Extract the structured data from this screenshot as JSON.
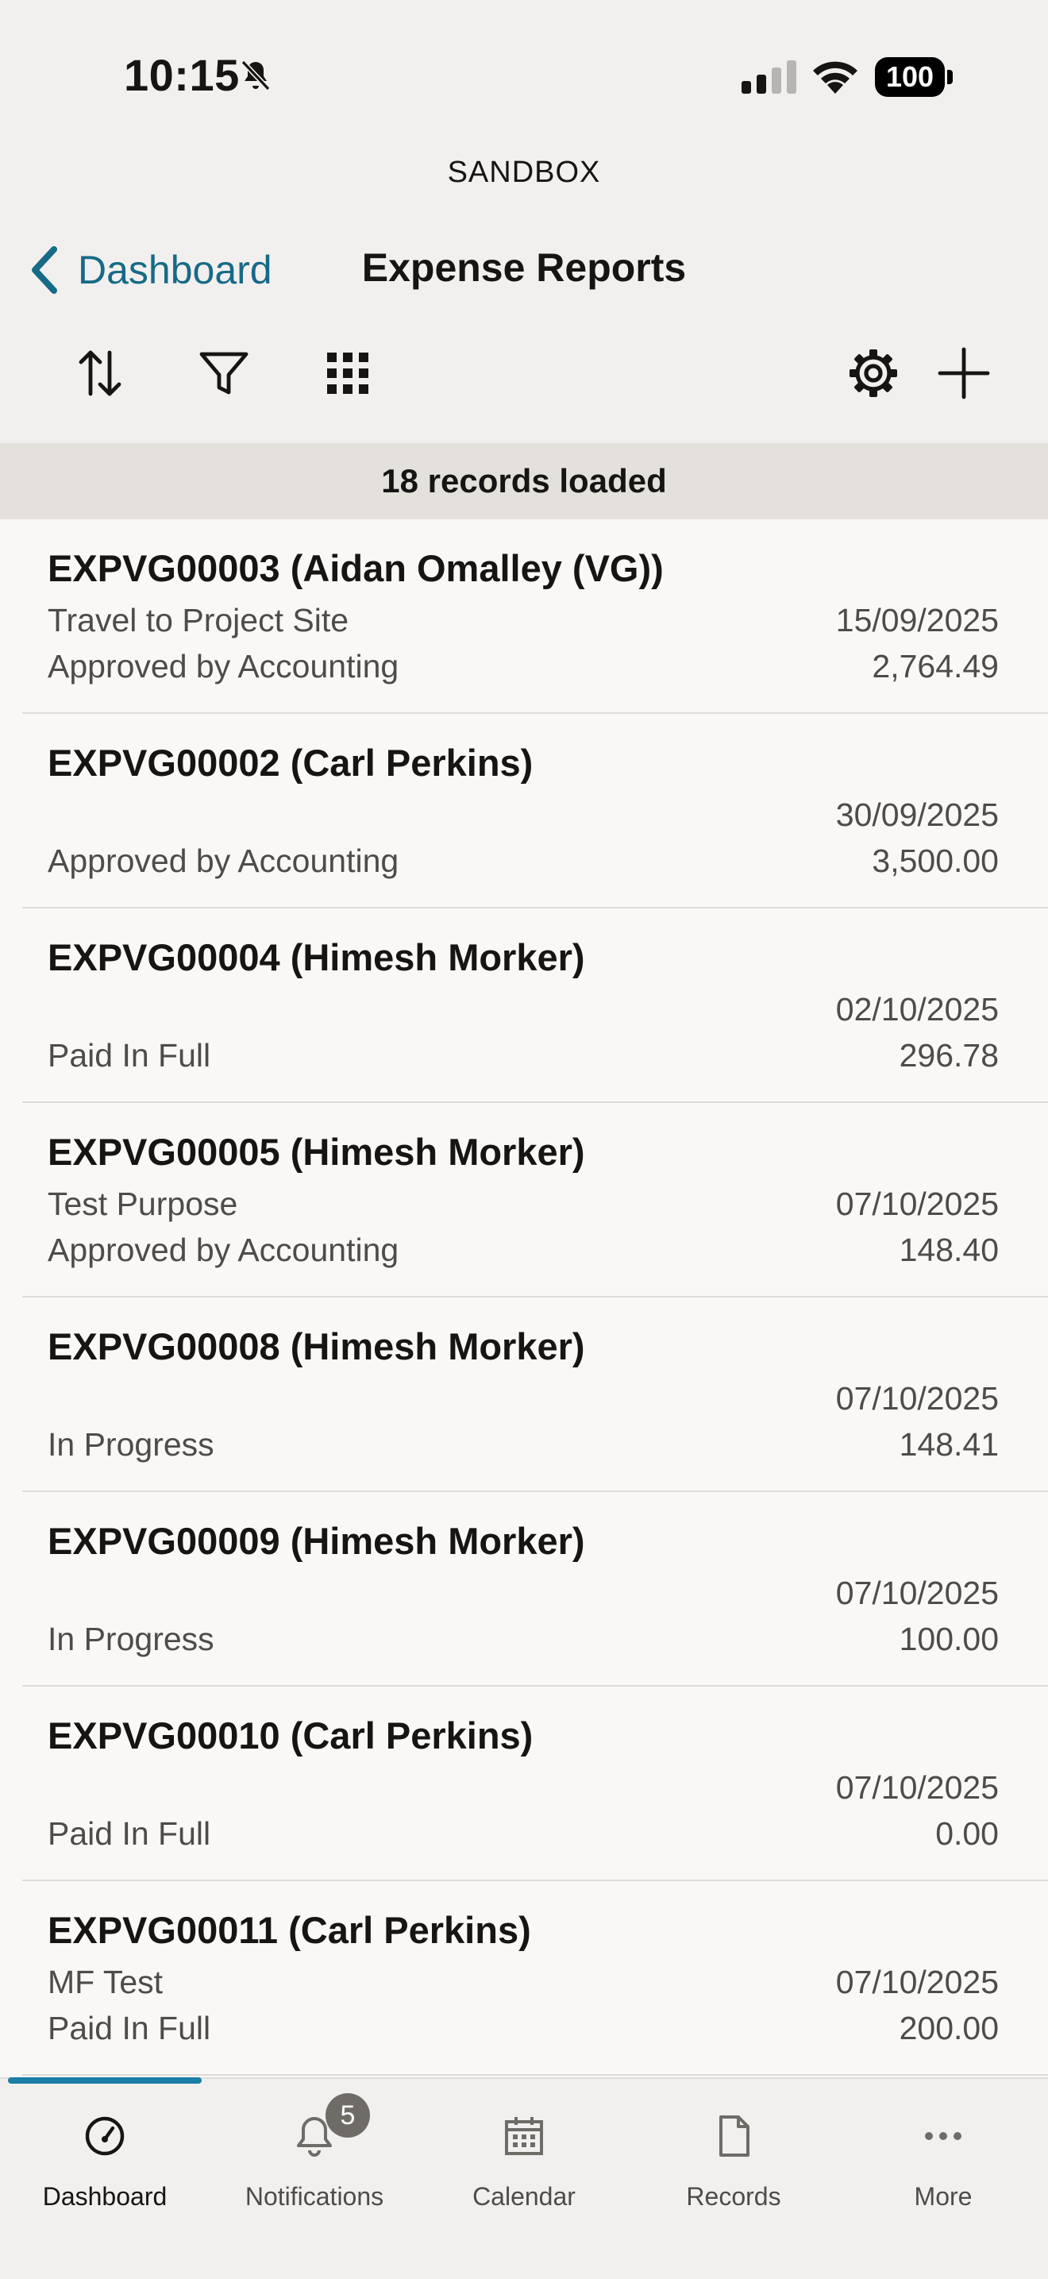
{
  "status_bar": {
    "time": "10:15",
    "battery": "100"
  },
  "environment": "SANDBOX",
  "nav": {
    "back_label": "Dashboard",
    "title": "Expense Reports"
  },
  "toolbar": {
    "icons": [
      "sort-icon",
      "filter-icon",
      "grid-icon",
      "settings-icon",
      "add-icon"
    ]
  },
  "records_banner": "18 records loaded",
  "records": [
    {
      "title": "EXPVG00003 (Aidan Omalley (VG))",
      "purpose": "Travel to Project Site",
      "status": "Approved by Accounting",
      "date": "15/09/2025",
      "amount": "2,764.49"
    },
    {
      "title": "EXPVG00002 (Carl Perkins)",
      "purpose": "",
      "status": "Approved by Accounting",
      "date": "30/09/2025",
      "amount": "3,500.00"
    },
    {
      "title": "EXPVG00004 (Himesh Morker)",
      "purpose": "",
      "status": "Paid In Full",
      "date": "02/10/2025",
      "amount": "296.78"
    },
    {
      "title": "EXPVG00005 (Himesh Morker)",
      "purpose": "Test Purpose",
      "status": "Approved by Accounting",
      "date": "07/10/2025",
      "amount": "148.40"
    },
    {
      "title": "EXPVG00008 (Himesh Morker)",
      "purpose": "",
      "status": "In Progress",
      "date": "07/10/2025",
      "amount": "148.41"
    },
    {
      "title": "EXPVG00009 (Himesh Morker)",
      "purpose": "",
      "status": "In Progress",
      "date": "07/10/2025",
      "amount": "100.00"
    },
    {
      "title": "EXPVG00010 (Carl Perkins)",
      "purpose": "",
      "status": "Paid In Full",
      "date": "07/10/2025",
      "amount": "0.00"
    },
    {
      "title": "EXPVG00011 (Carl Perkins)",
      "purpose": "MF Test",
      "status": "Paid In Full",
      "date": "07/10/2025",
      "amount": "200.00"
    }
  ],
  "tabs": [
    {
      "label": "Dashboard",
      "icon": "dashboard-icon",
      "active": true
    },
    {
      "label": "Notifications",
      "icon": "bell-icon",
      "badge": "5"
    },
    {
      "label": "Calendar",
      "icon": "calendar-icon"
    },
    {
      "label": "Records",
      "icon": "document-icon"
    },
    {
      "label": "More",
      "icon": "more-icon"
    }
  ],
  "colors": {
    "accent": "#1a7ea6",
    "link": "#176a87",
    "background": "#f1f0ee",
    "list_background": "#f9f8f6"
  }
}
